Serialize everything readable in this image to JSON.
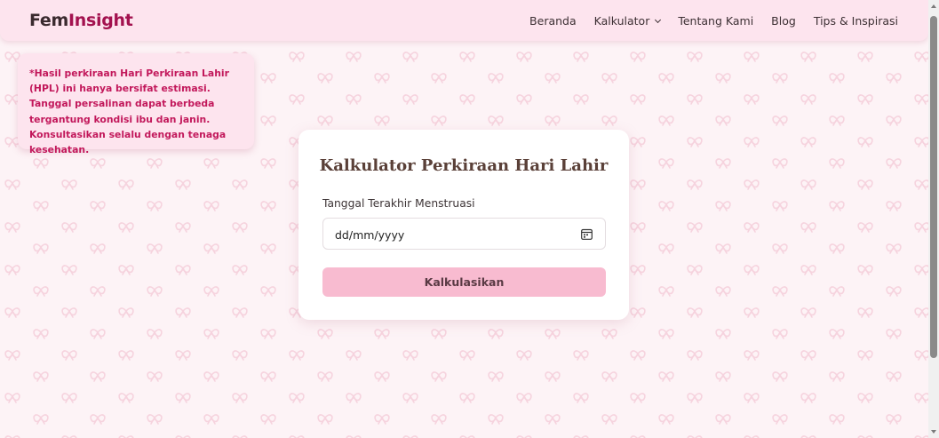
{
  "navbar": {
    "logo_part1": "Fem",
    "logo_part2": "Insight",
    "links": {
      "home": "Beranda",
      "calculator": "Kalkulator",
      "about": "Tentang Kami",
      "blog": "Blog",
      "tips": "Tips & Inspirasi"
    }
  },
  "notice": {
    "text": "*Hasil perkiraan Hari Perkiraan Lahir (HPL) ini hanya bersifat estimasi. Tanggal persalinan dapat berbeda tergantung kondisi ibu dan janin. Konsultasikan selalu dengan tenaga kesehatan."
  },
  "card": {
    "title": "Kalkulator Perkiraan Hari Lahir",
    "field_label": "Tanggal Terakhir Menstruasi",
    "date_placeholder": "dd/mm/yyyy",
    "button_label": "Kalkulasikan"
  },
  "colors": {
    "brand": "#a3124f",
    "background": "#fdf3f6",
    "nav_bg": "#fde4ee",
    "button_bg": "#f8bbd0",
    "notice_text": "#c2185b"
  },
  "icons": {
    "calendar": "calendar-icon",
    "dropdown": "chevron-down-icon",
    "pattern": "bow-icon"
  }
}
